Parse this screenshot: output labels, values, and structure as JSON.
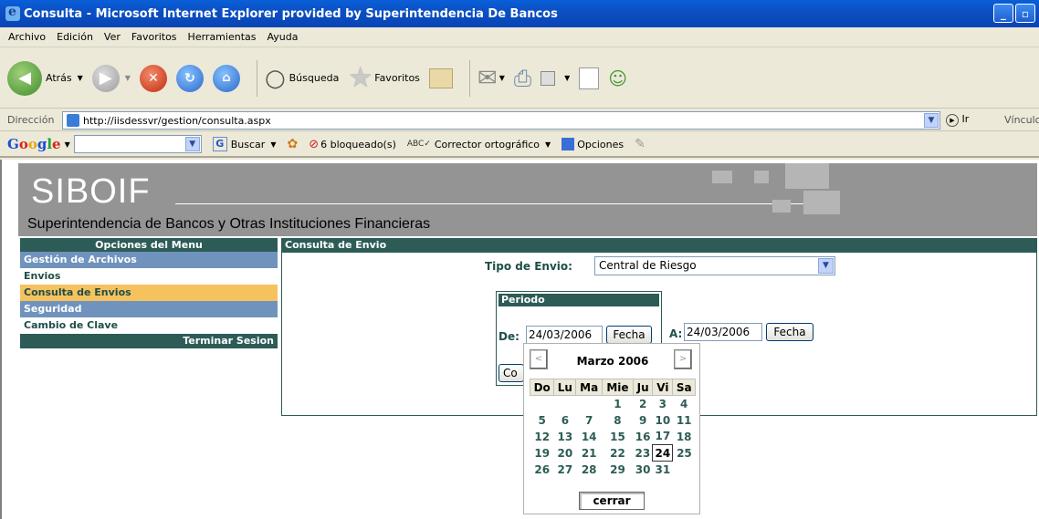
{
  "window": {
    "title": "Consulta - Microsoft Internet Explorer provided by Superintendencia De Bancos"
  },
  "menubar": [
    "Archivo",
    "Edición",
    "Ver",
    "Favoritos",
    "Herramientas",
    "Ayuda"
  ],
  "toolbar": {
    "back_label": "Atrás",
    "search_label": "Búsqueda",
    "favorites_label": "Favoritos"
  },
  "address": {
    "label": "Dirección",
    "url": "http://iisdessvr/gestion/consulta.aspx",
    "go_label": "Ir",
    "links_label": "Vínculo"
  },
  "googlebar": {
    "buscar": "Buscar",
    "bloqueados": "6 bloqueado(s)",
    "corrector": "Corrector ortográfico",
    "opciones": "Opciones"
  },
  "banner": {
    "logo": "SIBOIF",
    "subtitle": "Superintendencia de Bancos y Otras Instituciones Financieras"
  },
  "menu": {
    "title": "Opciones del Menu",
    "items": [
      {
        "label": "Gestión de Archivos",
        "kind": "sec"
      },
      {
        "label": "Envios",
        "kind": "link"
      },
      {
        "label": "Consulta de Envios",
        "kind": "act"
      },
      {
        "label": "Seguridad",
        "kind": "sec"
      },
      {
        "label": "Cambio de Clave",
        "kind": "link"
      }
    ],
    "logout": "Terminar Sesion"
  },
  "content": {
    "title": "Consulta de Envio",
    "tipo_label": "Tipo de Envio:",
    "tipo_value": "Central de Riesgo",
    "periodo_title": "Periodo",
    "de_label": "De:",
    "de_value": "24/03/2006",
    "a_label": "A:",
    "a_value": "24/03/2006",
    "fecha_button": "Fecha",
    "hidden_button_partial": "Co"
  },
  "calendar": {
    "month_title": "Marzo 2006",
    "prev": "<",
    "next": ">",
    "weekdays": [
      "Do",
      "Lu",
      "Ma",
      "Mie",
      "Ju",
      "Vi",
      "Sa"
    ],
    "weeks": [
      [
        "",
        "",
        "",
        "1",
        "2",
        "3",
        "4"
      ],
      [
        "5",
        "6",
        "7",
        "8",
        "9",
        "10",
        "11"
      ],
      [
        "12",
        "13",
        "14",
        "15",
        "16",
        "17",
        "18"
      ],
      [
        "19",
        "20",
        "21",
        "22",
        "23",
        "24",
        "25"
      ],
      [
        "26",
        "27",
        "28",
        "29",
        "30",
        "31",
        ""
      ]
    ],
    "selected_day": "24",
    "close_label": "cerrar"
  }
}
